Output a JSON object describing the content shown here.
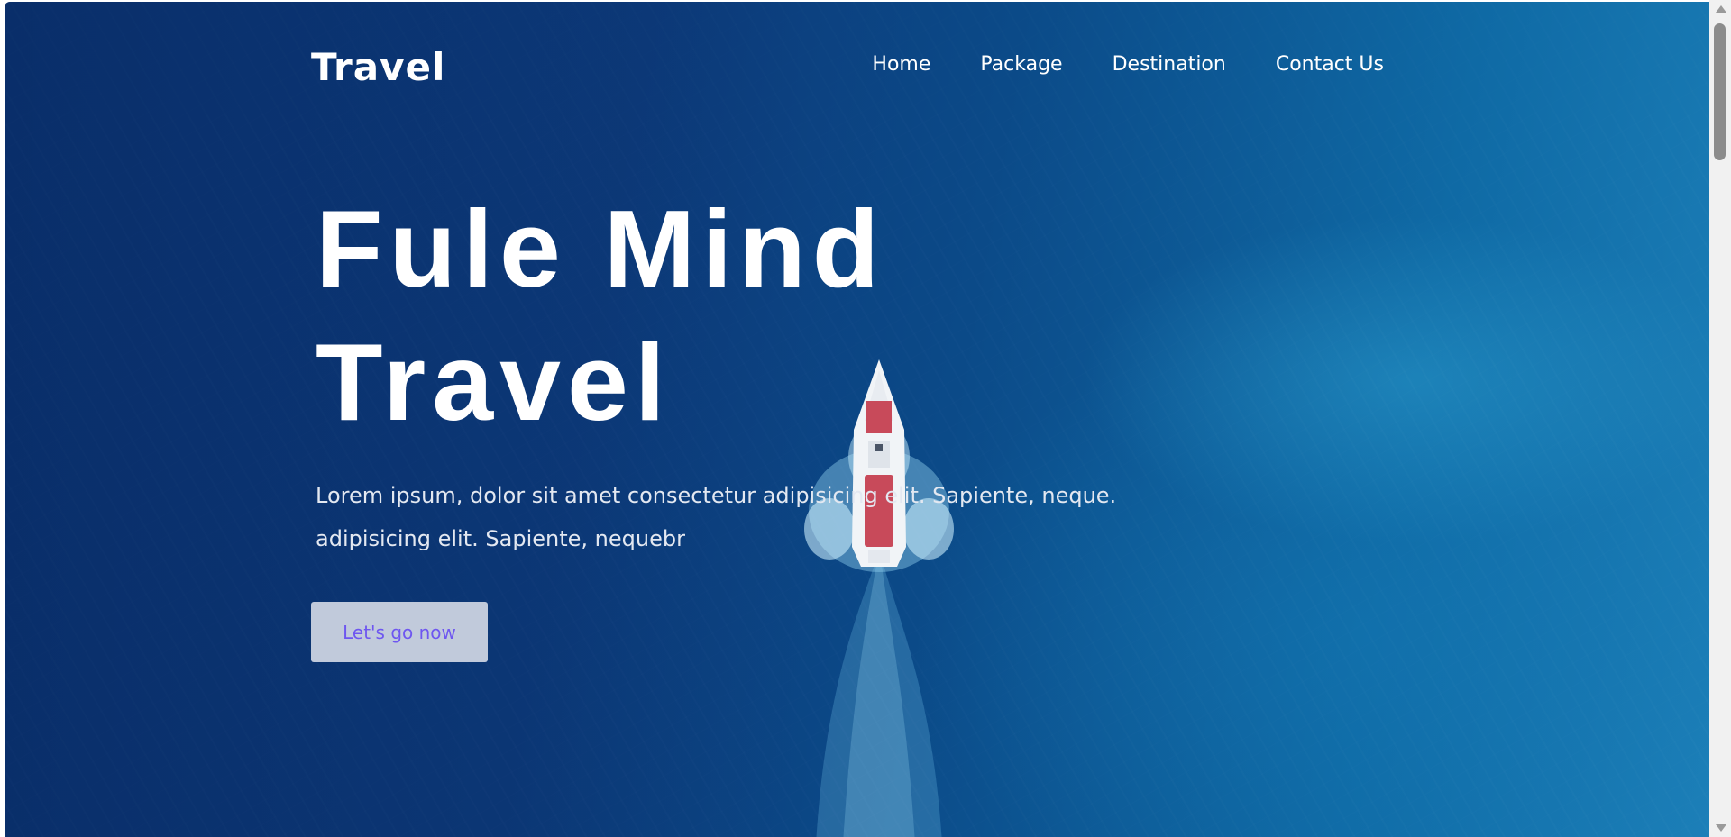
{
  "nav": {
    "logo": "Travel",
    "items": [
      {
        "label": "Home"
      },
      {
        "label": "Package"
      },
      {
        "label": "Destination"
      },
      {
        "label": "Contact Us"
      }
    ]
  },
  "hero": {
    "title_line1": "Fule Mind",
    "title_line2": "Travel",
    "text_line1": "Lorem ipsum, dolor sit amet consectetur adipisicing elit. Sapiente, neque.",
    "text_line2": "adipisicing elit. Sapiente, nequebr",
    "cta_label": "Let's go now"
  },
  "colors": {
    "ocean_dark": "#0b3778",
    "ocean_light": "#1c7fb8",
    "button_bg": "#c1cadb",
    "button_text": "#6e56f0",
    "boat_hull": "#c84a5a"
  },
  "icons": {
    "scroll_up": "scroll-up-arrow-icon",
    "scroll_down": "scroll-down-arrow-icon"
  }
}
